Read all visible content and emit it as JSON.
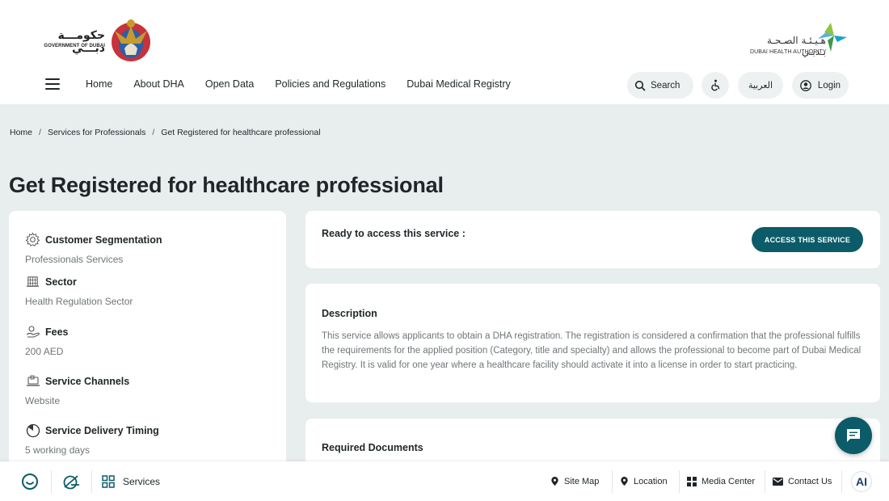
{
  "header": {
    "gov_logo_ar": "حكومـــة دبـــي",
    "gov_logo_en": "GOVERNMENT OF DUBAI",
    "dha_logo_ar": "هـيـئـة الصـحـة بـدبـي",
    "dha_logo_en": "DUBAI HEALTH AUTHORITY",
    "nav": [
      "Home",
      "About DHA",
      "Open Data",
      "Policies and Regulations",
      "Dubai Medical Registry"
    ],
    "search_label": "Search",
    "lang_label": "العربية",
    "login_label": "Login",
    "colors": {
      "brand_teal": "#0b5c68",
      "dha_green": "#8cc63f",
      "dha_blue": "#1ea0c9"
    }
  },
  "breadcrumb": [
    "Home",
    "Services for Professionals",
    "Get Registered for healthcare professional"
  ],
  "page_title": "Get Registered for healthcare professional",
  "info": [
    {
      "icon": "gear-icon",
      "label": "Customer Segmentation",
      "value": "Professionals Services"
    },
    {
      "icon": "building-icon",
      "label": "Sector",
      "value": "Health Regulation Sector"
    },
    {
      "icon": "hand-coin-icon",
      "label": "Fees",
      "value": "200 AED"
    },
    {
      "icon": "laptop-icon",
      "label": "Service Channels",
      "value": "Website"
    },
    {
      "icon": "clock-icon",
      "label": "Service Delivery Timing",
      "value": "5 working days"
    }
  ],
  "ready": {
    "label": "Ready to access this service :",
    "button": "ACCESS THIS SERVICE"
  },
  "description": {
    "title": "Description",
    "body": "This service allows applicants to obtain a DHA registration. The registration is considered a confirmation that the professional fulfills the requirements for the applied position (Category, title and specialty) and allows the professional to become part of Dubai Medical Registry. It is valid for one year where a healthcare facility should activate it into a license in order to start practicing."
  },
  "documents": {
    "title": "Required Documents"
  },
  "footer": {
    "services_label": "Services",
    "links": [
      "Site Map",
      "Location",
      "Media Center",
      "Contact Us"
    ],
    "ai_label": "AI"
  }
}
